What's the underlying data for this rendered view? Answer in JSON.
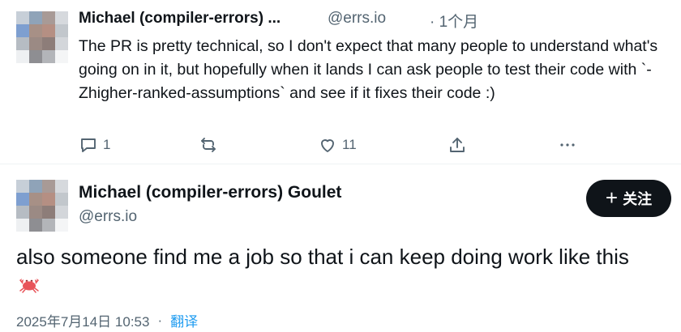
{
  "tweet1": {
    "author_name": "Michael (compiler-errors) ...",
    "handle": "@errs.io",
    "time": "· 1个月",
    "text": "The PR is pretty technical, so I don't expect that many people to understand what's going on in it, but hopefully when it lands I can ask people to test their code with `-Zhigher-ranked-assumptions` and see if it fixes their code :)",
    "replies": "1",
    "likes": "11",
    "icons": [
      "reply-icon",
      "retweet-icon",
      "like-icon",
      "share-icon",
      "more-icon"
    ]
  },
  "tweet2": {
    "author_name": "Michael (compiler-errors) Goulet",
    "handle": "@errs.io",
    "follow_plus": "+",
    "follow_label": "关注",
    "text": "also someone find me a job so that i can keep doing work like this",
    "emoji": "crab-emoji",
    "timestamp": "2025年7月14日 10:53",
    "separator": "·",
    "translate_label": "翻译"
  },
  "colors": {
    "text_primary": "#0f1419",
    "text_secondary": "#536471",
    "link": "#1d9bf0",
    "follow_bg": "#0f1419"
  }
}
